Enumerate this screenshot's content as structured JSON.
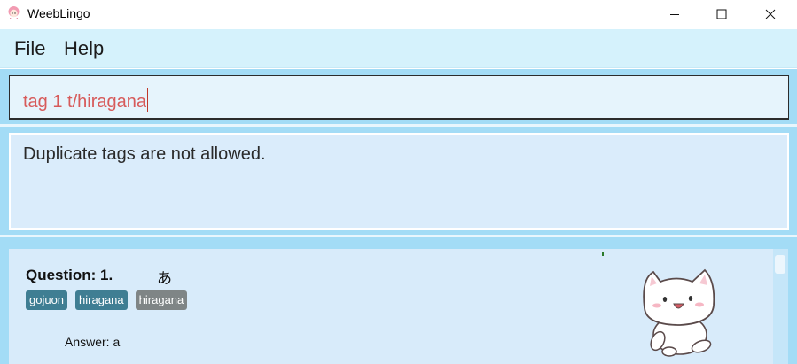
{
  "window": {
    "title": "WeebLingo",
    "app_icon": "pink-sakura-character-icon",
    "controls": [
      "minimize-icon",
      "maximize-icon",
      "close-icon"
    ]
  },
  "menu": {
    "items": [
      {
        "label": "File"
      },
      {
        "label": "Help"
      }
    ]
  },
  "command_box": {
    "value": "tag 1 t/hiragana",
    "text_color": "#d75a5a"
  },
  "result_display": {
    "message": "Duplicate tags are not allowed."
  },
  "flashcard_list": {
    "cards": [
      {
        "question_label": "Question: 1.",
        "question": "あ",
        "tags": [
          {
            "label": "gojuon",
            "color": "#3f7e93"
          },
          {
            "label": "hiragana",
            "color": "#3f7e93"
          },
          {
            "label": "hiragana",
            "color": "#7f8586"
          }
        ],
        "answer_label": "Answer: a",
        "image": "cute-white-cat-icon"
      }
    ]
  },
  "colors": {
    "menu_bg": "#d5f2fc",
    "body_bg": "#a3dcf6",
    "panel_bg": "#daecfb"
  }
}
